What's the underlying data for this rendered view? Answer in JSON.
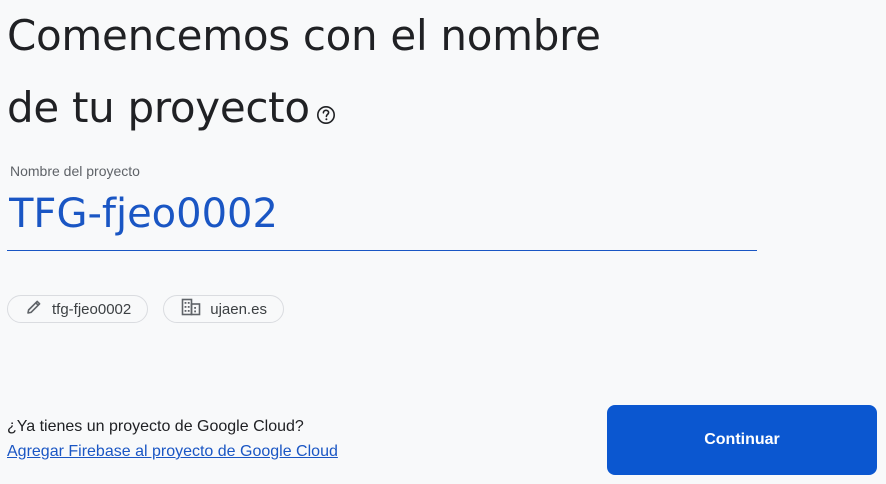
{
  "heading": {
    "line1": "Comencemos con el nombre",
    "line2": "de tu proyecto"
  },
  "project_name": {
    "label": "Nombre del proyecto",
    "value": "TFG-fjeo0002"
  },
  "chips": {
    "project_id": {
      "icon": "pencil-icon",
      "label": "tfg-fjeo0002"
    },
    "organization": {
      "icon": "building-icon",
      "label": "ujaen.es"
    }
  },
  "footer": {
    "question": "¿Ya tienes un proyecto de Google Cloud?",
    "link": "Agregar Firebase al proyecto de Google Cloud"
  },
  "actions": {
    "continue_label": "Continuar"
  },
  "colors": {
    "accent": "#0b57d0",
    "input_text": "#1a56c4",
    "background": "#f8f9fa"
  }
}
